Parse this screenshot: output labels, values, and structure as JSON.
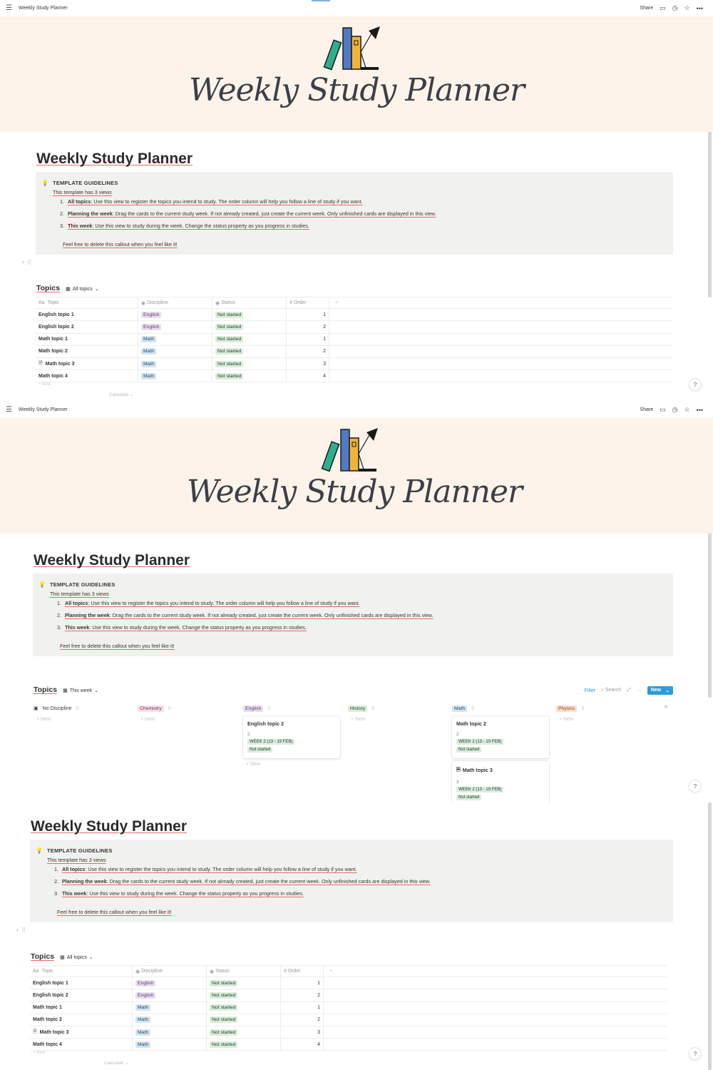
{
  "topbar": {
    "title": "Weekly Study Planner",
    "share": "Share"
  },
  "cover": {
    "title": "Weekly Study Planner"
  },
  "page": {
    "title": "Weekly Study Planner"
  },
  "callout": {
    "heading": "TEMPLATE GUIDELINES",
    "subheading": "This template has 3 views",
    "items": [
      {
        "num": "1.",
        "bold": "All topics",
        "text": ": Use this view to register the topics you intend to study. The order column will help you follow a line of study if you want."
      },
      {
        "num": "2.",
        "bold": "Planning the week",
        "text": ": Drag the cards to the current study week. If not already created, just create the current week. Only unfinished cards are displayed in this view."
      },
      {
        "num": "3.",
        "bold": "This week",
        "text": ": Use this view to study during the week. Change the status property as you progress in studies."
      }
    ],
    "footer": "Feel free to delete this callout when you feel like it!"
  },
  "database": {
    "title": "Topics",
    "views": {
      "all": "All topics",
      "week": "This week"
    },
    "columns": [
      "Topic",
      "Discipline",
      "Status",
      "Order"
    ],
    "rows": [
      {
        "topic": "English topic 1",
        "discipline": "English",
        "status": "Not started",
        "order": "1",
        "has_page": false
      },
      {
        "topic": "English topic 2",
        "discipline": "English",
        "status": "Not started",
        "order": "2",
        "has_page": false
      },
      {
        "topic": "Math topic 1",
        "discipline": "Math",
        "status": "Not started",
        "order": "1",
        "has_page": false
      },
      {
        "topic": "Math topic 2",
        "discipline": "Math",
        "status": "Not started",
        "order": "2",
        "has_page": false
      },
      {
        "topic": "Math topic 3",
        "discipline": "Math",
        "status": "Not started",
        "order": "3",
        "has_page": true
      },
      {
        "topic": "Math topic 4",
        "discipline": "Math",
        "status": "Not started",
        "order": "4",
        "has_page": false
      }
    ],
    "new_label": "New",
    "calculate_label": "Calculate"
  },
  "board": {
    "tools": {
      "filter": "Filter",
      "search": "Search",
      "new": "New"
    },
    "columns": [
      {
        "name": "No Discipline",
        "count": "0",
        "cards": []
      },
      {
        "name": "Chemistry",
        "count": "0",
        "cards": []
      },
      {
        "name": "English",
        "count": "1",
        "cards": [
          {
            "title": "English topic 2",
            "order": "2",
            "week": "WEEK 2 (13 - 19 FEB)",
            "status": "Not started"
          }
        ]
      },
      {
        "name": "History",
        "count": "0",
        "cards": []
      },
      {
        "name": "Math",
        "count": "2",
        "cards": [
          {
            "title": "Math topic 2",
            "order": "2",
            "week": "WEEK 2 (13 - 19 FEB)",
            "status": "Not started"
          },
          {
            "title": "Math topic 3",
            "order": "3",
            "week": "WEEK 2 (13 - 19 FEB)",
            "status": "Not started"
          }
        ]
      },
      {
        "name": "Physics",
        "count": "0",
        "cards": []
      }
    ],
    "new_label": "New"
  },
  "help": "?"
}
